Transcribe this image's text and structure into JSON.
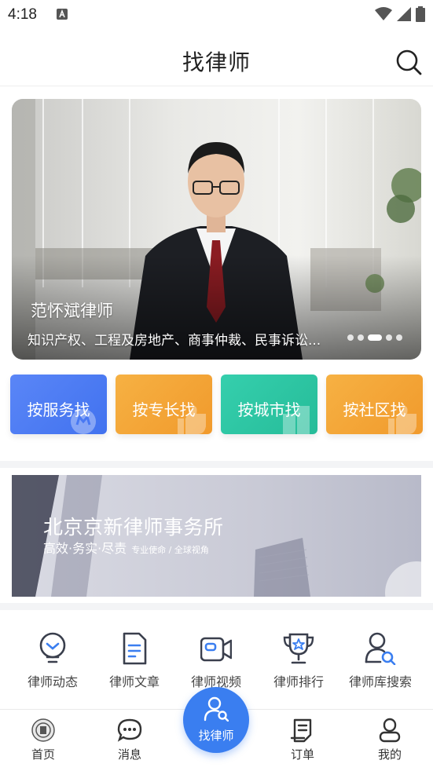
{
  "status_bar": {
    "time": "4:18"
  },
  "header": {
    "title": "找律师"
  },
  "banner": {
    "lawyer_name": "范怀斌律师",
    "description": "知识产权、工程及房地产、商事仲裁、民事诉讼...",
    "slide_count": 5,
    "active_slide": 3
  },
  "quick_filters": [
    {
      "label": "按服务找",
      "color": "#4f7ff5"
    },
    {
      "label": "按专长找",
      "color": "#f4a93a"
    },
    {
      "label": "按城市找",
      "color": "#30c7a4"
    },
    {
      "label": "按社区找",
      "color": "#f4a63a"
    }
  ],
  "law_firm": {
    "name": "北京京新律师事务所",
    "slogan": "高效·务实·尽责",
    "tagline": "专业使命 / 全球视角"
  },
  "features": [
    {
      "label": "律师动态",
      "icon": "bulb-icon"
    },
    {
      "label": "律师文章",
      "icon": "document-icon"
    },
    {
      "label": "律师视频",
      "icon": "video-icon"
    },
    {
      "label": "律师排行",
      "icon": "trophy-icon"
    },
    {
      "label": "律师库搜索",
      "icon": "user-search-icon"
    }
  ],
  "tabbar": {
    "items": [
      {
        "label": "首页",
        "icon": "home-emblem-icon"
      },
      {
        "label": "消息",
        "icon": "message-icon"
      },
      {
        "label": "找律师",
        "icon": "find-lawyer-icon"
      },
      {
        "label": "订单",
        "icon": "order-icon"
      },
      {
        "label": "我的",
        "icon": "profile-icon"
      }
    ],
    "active_color": "#3a7ef0"
  }
}
